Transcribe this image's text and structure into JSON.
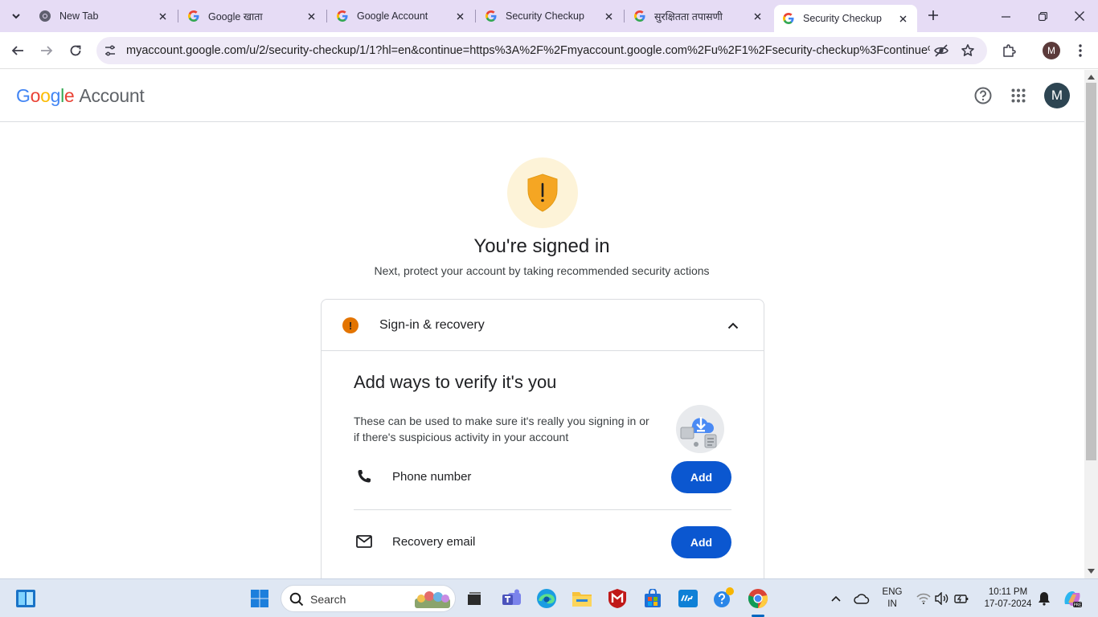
{
  "browser": {
    "tabs": [
      {
        "title": "New Tab",
        "favicon": "chrome-icon",
        "active": false
      },
      {
        "title": "Google खाता",
        "favicon": "google-g-icon",
        "active": false
      },
      {
        "title": "Google Account",
        "favicon": "google-g-icon",
        "active": false
      },
      {
        "title": "Security Checkup",
        "favicon": "google-g-icon",
        "active": false
      },
      {
        "title": "सुरक्षितता तपासणी",
        "favicon": "google-g-icon",
        "active": false
      },
      {
        "title": "Security Checkup",
        "favicon": "google-g-icon",
        "active": true
      }
    ],
    "url": "myaccount.google.com/u/2/security-checkup/1/1?hl=en&continue=https%3A%2F%2Fmyaccount.google.com%2Fu%2F1%2Fsecurity-checkup%3Fcontinue%3D...",
    "profile_initial": "M",
    "tabstrip_color": "#e6dcf5"
  },
  "header": {
    "logo_text": "Google",
    "account_text": "Account",
    "avatar_initial": "M",
    "avatar_color": "#2d4552"
  },
  "hero": {
    "icon": "shield-warning-icon",
    "title": "You're signed in",
    "subtitle": "Next, protect your account by taking recommended security actions"
  },
  "card": {
    "header_title": "Sign-in & recovery",
    "section_title": "Add ways to verify it's you",
    "description": "These can be used to make sure it's really you signing in or if there's suspicious activity in your account",
    "rows": [
      {
        "icon": "phone-icon",
        "label": "Phone number",
        "button": "Add"
      },
      {
        "icon": "mail-icon",
        "label": "Recovery email",
        "button": "Add"
      }
    ],
    "accent_color": "#0b57d0",
    "warning_color": "#e37400"
  },
  "taskbar": {
    "search_placeholder": "Search",
    "language_top": "ENG",
    "language_bottom": "IN",
    "time": "10:11 PM",
    "date": "17-07-2024"
  }
}
